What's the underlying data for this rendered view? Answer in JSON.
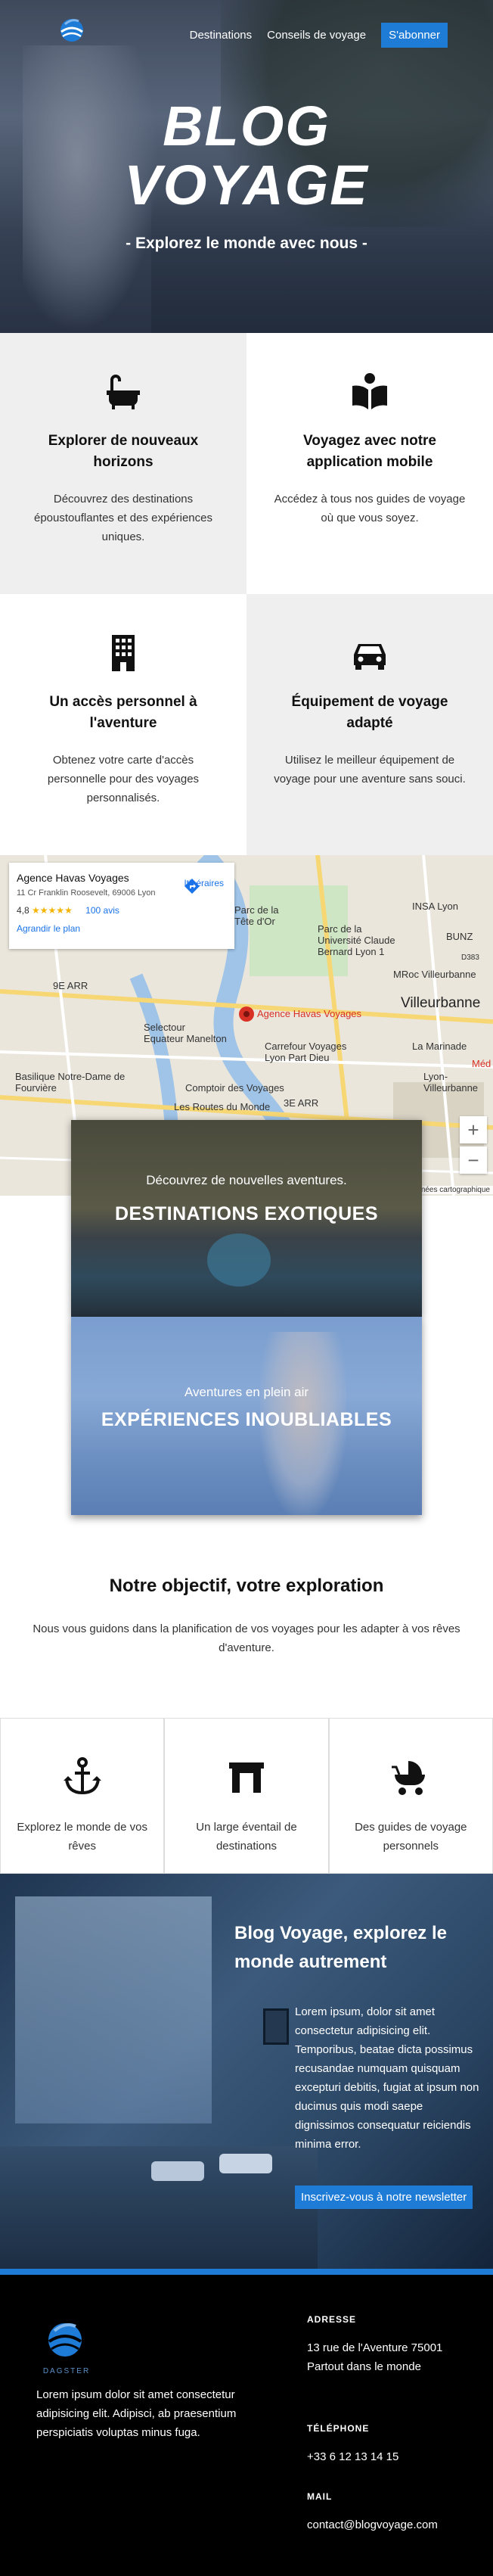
{
  "header": {
    "nav": [
      "Destinations",
      "Conseils de voyage"
    ],
    "subscribe_label": "S'abonner",
    "title_line1": "BLOG",
    "title_line2": "VOYAGE",
    "subtitle": "- Explorez le monde avec nous -"
  },
  "features": [
    {
      "icon": "bathtub-icon",
      "title": "Explorer de nouveaux horizons",
      "text": "Découvrez des destinations époustouflantes et des expériences uniques."
    },
    {
      "icon": "book-icon",
      "title": "Voyagez avec notre application mobile",
      "text": "Accédez à tous nos guides de voyage où que vous soyez."
    },
    {
      "icon": "building-icon",
      "title": "Un accès personnel à l'aventure",
      "text": "Obtenez votre carte d'accès personnelle pour des voyages personnalisés."
    },
    {
      "icon": "car-icon",
      "title": "Équipement de voyage adapté",
      "text": "Utilisez le meilleur équipement de voyage pour une aventure sans souci."
    }
  ],
  "map": {
    "place_name": "Agence Havas Voyages",
    "address": "11 Cr Franklin Roosevelt, 69006 Lyon",
    "rating": "4,8",
    "stars": "★★★★★",
    "reviews": "100 avis",
    "bigger_map": "Agrandir le plan",
    "directions": "Itinéraires",
    "pin_label": "Agence Havas Voyages",
    "labels": [
      "Villeurbanne",
      "Selectour Equateur Manelton",
      "Basilique Notre-Dame de Fourvière",
      "Comptoir des Voyages",
      "Carrefour Voyages Lyon Part Dieu",
      "La Marinade",
      "MRoc Villeurbanne",
      "Parc de la Tête d'Or",
      "Lyon-Villeurbanne",
      "Les Routes du Monde",
      "INSA Lyon",
      "BUNZ",
      "Parc de la Université Claude Bernard Lyon 1",
      "9E ARR",
      "3E ARR",
      "D383",
      "Méd"
    ],
    "zoom_in": "+",
    "zoom_out": "−",
    "credit": "Données cartographique"
  },
  "promos": [
    {
      "small": "Découvrez de nouvelles aventures.",
      "big": "DESTINATIONS EXOTIQUES"
    },
    {
      "small": "Aventures en plein air",
      "big": "EXPÉRIENCES INOUBLIABLES"
    }
  ],
  "objective": {
    "title": "Notre objectif, votre exploration",
    "text": "Nous vous guidons dans la planification de vos voyages pour les adapter à vos rêves d'aventure."
  },
  "boxes": [
    {
      "icon": "anchor-icon",
      "text": "Explorez le monde de vos rêves"
    },
    {
      "icon": "gate-icon",
      "text": "Un large éventail de destinations"
    },
    {
      "icon": "stroller-icon",
      "text": "Des guides de voyage personnels"
    }
  ],
  "newsletter": {
    "title": "Blog Voyage, explorez le monde autrement",
    "text": "Lorem ipsum, dolor sit amet consectetur adipisicing elit. Temporibus, beatae dicta possimus recusandae numquam quisquam excepturi debitis, fugiat at ipsum non ducimus quis modi saepe dignissimos consequatur reiciendis minima error.",
    "button": "Inscrivez-vous à notre newsletter"
  },
  "footer": {
    "brand": "DAGSTER",
    "about": "Lorem ipsum dolor sit amet consectetur adipisicing elit. Adipisci, ab praesentium perspiciatis voluptas minus fuga.",
    "address_label": "ADRESSE",
    "address": "13 rue de l'Aventure 75001 Partout dans le monde",
    "phone_label": "TÉLÉPHONE",
    "phone": "+33 6 12 13 14 15",
    "mail_label": "MAIL",
    "mail": "contact@blogvoyage.com"
  },
  "colors": {
    "accent": "#1e7bd6",
    "footer_bg": "#000000",
    "feature_grey": "#efefef"
  }
}
